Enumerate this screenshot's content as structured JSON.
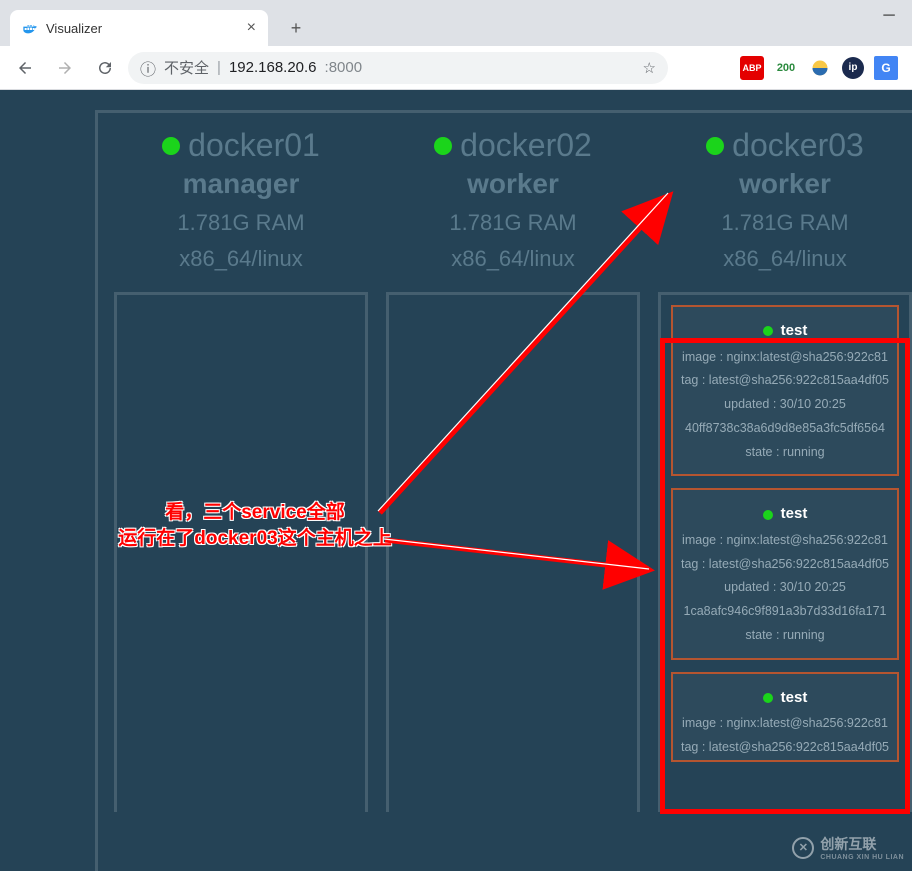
{
  "browser": {
    "tab_title": "Visualizer",
    "address_insecure": "不安全",
    "address_host": "192.168.20.6",
    "address_port": ":8000",
    "ext_abp": "ABP",
    "ext_200": "200",
    "ext_ip": "ip"
  },
  "nodes": [
    {
      "name": "docker01",
      "role": "manager",
      "ram": "1.781G RAM",
      "arch": "x86_64/linux",
      "services": []
    },
    {
      "name": "docker02",
      "role": "worker",
      "ram": "1.781G RAM",
      "arch": "x86_64/linux",
      "services": []
    },
    {
      "name": "docker03",
      "role": "worker",
      "ram": "1.781G RAM",
      "arch": "x86_64/linux",
      "services": [
        {
          "name": "test",
          "image": "image : nginx:latest@sha256:922c81",
          "tag": "tag : latest@sha256:922c815aa4df05",
          "updated": "updated : 30/10 20:25",
          "id": "40ff8738c38a6d9d8e85a3fc5df6564",
          "state": "state : running"
        },
        {
          "name": "test",
          "image": "image : nginx:latest@sha256:922c81",
          "tag": "tag : latest@sha256:922c815aa4df05",
          "updated": "updated : 30/10 20:25",
          "id": "1ca8afc946c9f891a3b7d33d16fa171",
          "state": "state : running"
        },
        {
          "name": "test",
          "image": "image : nginx:latest@sha256:922c81",
          "tag": "tag : latest@sha256:922c815aa4df05",
          "updated": "",
          "id": "",
          "state": ""
        }
      ]
    }
  ],
  "annotation": {
    "line1": "看，三个service全部",
    "line2": "运行在了docker03这个主机之上"
  },
  "watermark": {
    "brand": "创新互联",
    "sub": "CHUANG XIN HU LIAN"
  }
}
